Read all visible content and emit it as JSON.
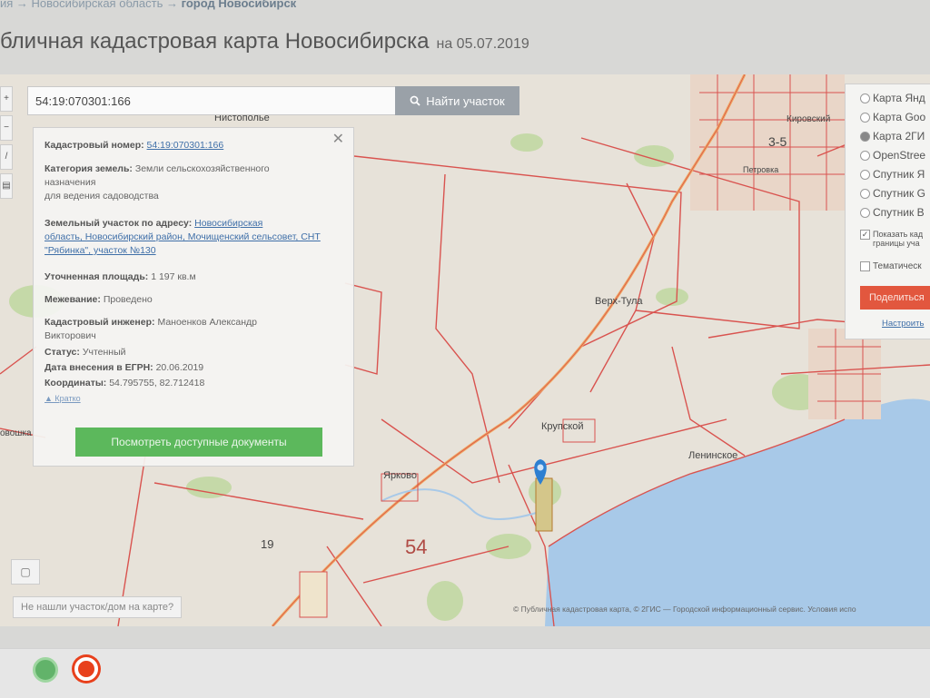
{
  "breadcrumb": {
    "prefix": "ия →",
    "region": "Новосибирская область →",
    "city": "город Новосибирск"
  },
  "header": {
    "title": "бличная кадастровая карта Новосибирска",
    "date": "на 05.07.2019"
  },
  "search": {
    "value": "54:19:070301:166",
    "button_label": "Найти участок"
  },
  "info": {
    "cadastral_label": "Кадастровый номер:",
    "cadastral_value": "54:19:070301:166",
    "category_label": "Категория земель:",
    "category_value": "Земли сельскохозяйственного",
    "category_value2": "назначения",
    "usage_value": "для ведения садоводства",
    "address_label": "Земельный участок по адресу:",
    "address_line1": "Новосибирская",
    "address_line2": "область, Новосибирский район, Мочищенский сельсовет, СНТ",
    "address_line3": "\"Рябинка\", участок №130",
    "area_label": "Уточненная площадь:",
    "area_value": "1 197 кв.м",
    "survey_label": "Межевание:",
    "survey_value": "Проведено",
    "engineer_label": "Кадастровый инженер:",
    "engineer_value": "Маноенков Александр",
    "engineer_value2": "Викторович",
    "status_label": "Статус:",
    "status_value": "Учтенный",
    "egrn_label": "Дата внесения в ЕГРН:",
    "egrn_value": "20.06.2019",
    "coords_label": "Координаты:",
    "coords_value": "54.795755, 82.712418",
    "collapse_label": "▲ Кратко",
    "docs_button": "Посмотреть доступные документы"
  },
  "layers": {
    "options": [
      {
        "label": "Карта Янд",
        "selected": false
      },
      {
        "label": "Карта Goo",
        "selected": false
      },
      {
        "label": "Карта 2ГИ",
        "selected": true
      },
      {
        "label": "OpenStree",
        "selected": false
      },
      {
        "label": "Спутник Я",
        "selected": false
      },
      {
        "label": "Спутник G",
        "selected": false
      },
      {
        "label": "Спутник B",
        "selected": false
      }
    ],
    "show_label_1": "Показать кад",
    "show_label_2": "границы уча",
    "thematic_label": "Тематическ",
    "share_button": "Поделиться",
    "settings_link": "Настроить"
  },
  "map_labels": {
    "nistopolye": "Нистополье",
    "verkh_tula": "Верх-Тула",
    "krupskoy": "Крупской",
    "leninskoe": "Ленинское",
    "yarkovo": "Ярково",
    "region19": "19",
    "region54": "54",
    "kirovsky": "Кировский",
    "district35": "3-5",
    "novoshka": "овошка",
    "petrovka": "Петровка"
  },
  "not_found": "Не нашли участок/дом на карте?",
  "attribution": "© Публичная кадастровая карта, © 2ГИС — Городской информационный сервис. Условия испо",
  "colors": {
    "accent_green": "#5cb85c",
    "share_red": "#e2573e",
    "boundary_red": "#d9534f",
    "water": "#a8c9e8",
    "marker_blue": "#2d7fd1"
  }
}
